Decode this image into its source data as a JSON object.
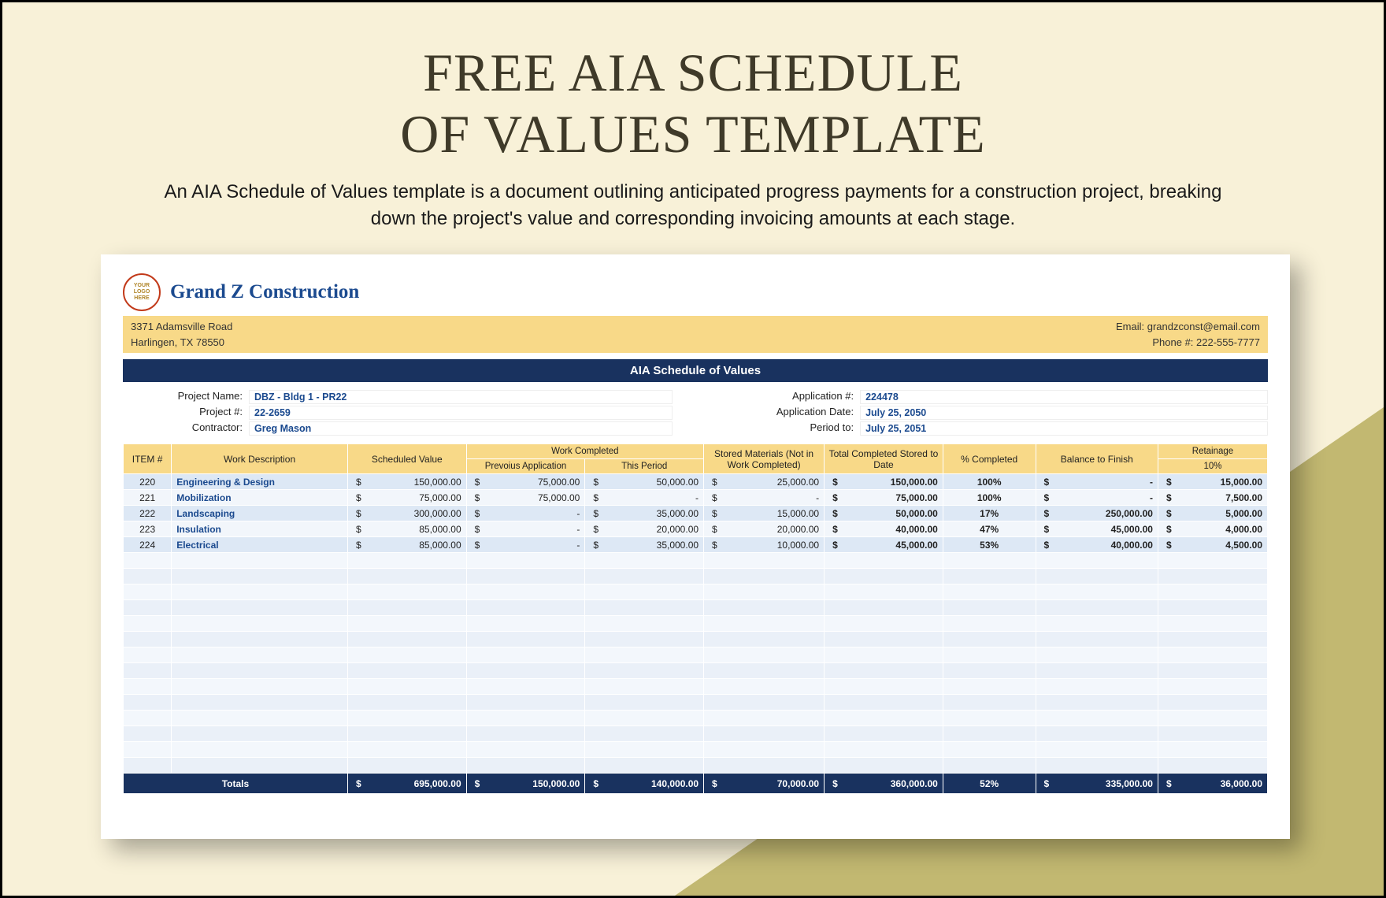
{
  "page": {
    "title_line1": "FREE AIA SCHEDULE",
    "title_line2": "OF VALUES TEMPLATE",
    "description": "An AIA Schedule of Values template is a document outlining anticipated progress payments for a construction project, breaking down the project's value and corresponding invoicing amounts at each stage."
  },
  "company": {
    "logo_text1": "YOUR",
    "logo_text2": "LOGO",
    "logo_text3": "HERE",
    "name": "Grand Z Construction",
    "address_line1": "3371 Adamsville Road",
    "address_line2": "Harlingen, TX 78550",
    "email_label": "Email: ",
    "email": "grandzconst@email.com",
    "phone_label": "Phone #: ",
    "phone": "222-555-7777"
  },
  "doc_title": "AIA Schedule of Values",
  "info": {
    "project_name_label": "Project Name:",
    "project_name": "DBZ - Bldg 1 - PR22",
    "project_num_label": "Project #:",
    "project_num": "22-2659",
    "contractor_label": "Contractor:",
    "contractor": "Greg Mason",
    "app_num_label": "Application #:",
    "app_num": "224478",
    "app_date_label": "Application Date:",
    "app_date": "July 25, 2050",
    "period_to_label": "Period to:",
    "period_to": "July 25, 2051"
  },
  "headers": {
    "item": "ITEM #",
    "desc": "Work Description",
    "sched": "Scheduled Value",
    "work_completed": "Work Completed",
    "prev_app": "Prevoius Application",
    "this_period": "This Period",
    "stored": "Stored Materials (Not in Work Completed)",
    "tot_date": "Total Completed Stored to Date",
    "pct": "% Completed",
    "balance": "Balance to Finish",
    "retainage": "Retainage",
    "retainage_pct": "10%"
  },
  "rows": [
    {
      "item": "220",
      "desc": "Engineering & Design",
      "sched": "150,000.00",
      "prev": "75,000.00",
      "period": "50,000.00",
      "stored": "25,000.00",
      "totdate": "150,000.00",
      "pct": "100%",
      "balance": "-",
      "ret": "15,000.00"
    },
    {
      "item": "221",
      "desc": "Mobilization",
      "sched": "75,000.00",
      "prev": "75,000.00",
      "period": "-",
      "stored": "-",
      "totdate": "75,000.00",
      "pct": "100%",
      "balance": "-",
      "ret": "7,500.00"
    },
    {
      "item": "222",
      "desc": "Landscaping",
      "sched": "300,000.00",
      "prev": "-",
      "period": "35,000.00",
      "stored": "15,000.00",
      "totdate": "50,000.00",
      "pct": "17%",
      "balance": "250,000.00",
      "ret": "5,000.00"
    },
    {
      "item": "223",
      "desc": "Insulation",
      "sched": "85,000.00",
      "prev": "-",
      "period": "20,000.00",
      "stored": "20,000.00",
      "totdate": "40,000.00",
      "pct": "47%",
      "balance": "45,000.00",
      "ret": "4,000.00"
    },
    {
      "item": "224",
      "desc": "Electrical",
      "sched": "85,000.00",
      "prev": "-",
      "period": "35,000.00",
      "stored": "10,000.00",
      "totdate": "45,000.00",
      "pct": "53%",
      "balance": "40,000.00",
      "ret": "4,500.00"
    }
  ],
  "blank_rows": 14,
  "totals": {
    "label": "Totals",
    "sched": "695,000.00",
    "prev": "150,000.00",
    "period": "140,000.00",
    "stored": "70,000.00",
    "totdate": "360,000.00",
    "pct": "52%",
    "balance": "335,000.00",
    "ret": "36,000.00"
  },
  "chart_data": {
    "type": "table",
    "title": "AIA Schedule of Values",
    "columns": [
      "ITEM #",
      "Work Description",
      "Scheduled Value",
      "Prevoius Application",
      "This Period",
      "Stored Materials (Not in Work Completed)",
      "Total Completed Stored to Date",
      "% Completed",
      "Balance to Finish",
      "Retainage 10%"
    ],
    "rows": [
      [
        220,
        "Engineering & Design",
        150000.0,
        75000.0,
        50000.0,
        25000.0,
        150000.0,
        100,
        0.0,
        15000.0
      ],
      [
        221,
        "Mobilization",
        75000.0,
        75000.0,
        0.0,
        0.0,
        75000.0,
        100,
        0.0,
        7500.0
      ],
      [
        222,
        "Landscaping",
        300000.0,
        0.0,
        35000.0,
        15000.0,
        50000.0,
        17,
        250000.0,
        5000.0
      ],
      [
        223,
        "Insulation",
        85000.0,
        0.0,
        20000.0,
        20000.0,
        40000.0,
        47,
        45000.0,
        4000.0
      ],
      [
        224,
        "Electrical",
        85000.0,
        0.0,
        35000.0,
        10000.0,
        45000.0,
        53,
        40000.0,
        4500.0
      ]
    ],
    "totals": [
      null,
      "Totals",
      695000.0,
      150000.0,
      140000.0,
      70000.0,
      360000.0,
      52,
      335000.0,
      36000.0
    ]
  }
}
